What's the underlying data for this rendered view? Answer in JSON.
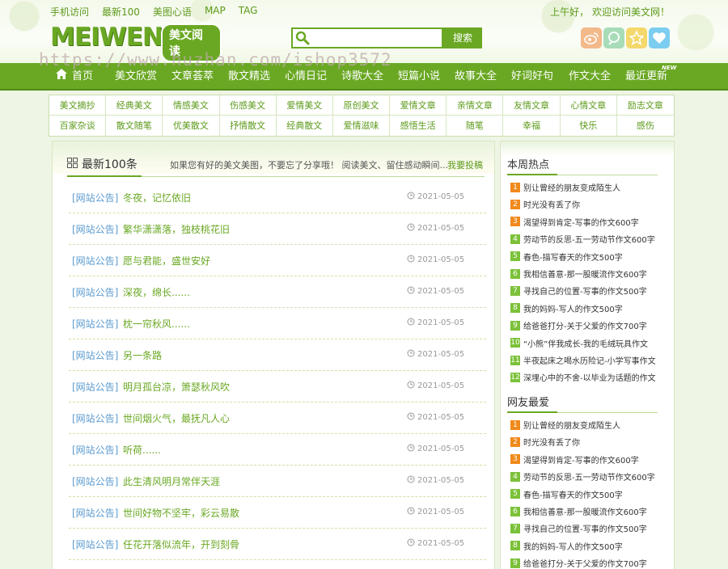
{
  "top": {
    "links": [
      "手机访问",
      "最新100",
      "美图心语",
      "MAP",
      "TAG"
    ],
    "greeting": "上午好，  欢迎访问美文网！",
    "logo_en": "MEIWEN",
    "logo_cn": "美文阅读",
    "search_placeholder": "",
    "search_button": "搜索",
    "watermark": "https://www.huzhan.com/ishop3572"
  },
  "icons": {
    "search": "magnifier-icon",
    "weibo": "weibo-icon",
    "qzone": "qzone-icon",
    "favorite": "star-icon",
    "love": "heart-icon"
  },
  "nav": {
    "items": [
      "首页",
      "美文欣赏",
      "文章荟萃",
      "散文精选",
      "心情日记",
      "诗歌大全",
      "短篇小说",
      "故事大全",
      "好词好句",
      "作文大全",
      "最近更新"
    ],
    "new_badge": "NEW"
  },
  "categories": [
    [
      "美文摘抄",
      "经典美文",
      "情感美文",
      "伤感美文",
      "爱情美文",
      "原创美文",
      "爱情文章",
      "亲情文章",
      "友情文章",
      "心情文章",
      "励志文章"
    ],
    [
      "百家杂谈",
      "散文随笔",
      "优美散文",
      "抒情散文",
      "经典散文",
      "爱情滋味",
      "感悟生活",
      "随笔",
      "幸福",
      "快乐",
      "感伤"
    ]
  ],
  "main": {
    "title": "最新100条",
    "tip": "如果您有好的美文美图，不要忘了分享哦！ 阅读美文、留住感动瞬间...",
    "contribute": "我要投稿",
    "articles": [
      {
        "cat": "[网站公告]",
        "title": "冬夜，记忆依旧",
        "date": "2021-05-05"
      },
      {
        "cat": "[网站公告]",
        "title": "繁华潇潇落，独枝桃花旧",
        "date": "2021-05-05"
      },
      {
        "cat": "[网站公告]",
        "title": "愿与君能，盛世安好",
        "date": "2021-05-05"
      },
      {
        "cat": "[网站公告]",
        "title": "深夜，绵长......",
        "date": "2021-05-05"
      },
      {
        "cat": "[网站公告]",
        "title": "枕一帘秋风......",
        "date": "2021-05-05"
      },
      {
        "cat": "[网站公告]",
        "title": "另一条路",
        "date": "2021-05-05"
      },
      {
        "cat": "[网站公告]",
        "title": "明月孤台凉，箫瑟秋风吹",
        "date": "2021-05-05"
      },
      {
        "cat": "[网站公告]",
        "title": "世间烟火气，最抚凡人心",
        "date": "2021-05-05"
      },
      {
        "cat": "[网站公告]",
        "title": "听荷......",
        "date": "2021-05-05"
      },
      {
        "cat": "[网站公告]",
        "title": "此生清风明月常伴天涯",
        "date": "2021-05-05"
      },
      {
        "cat": "[网站公告]",
        "title": "世间好物不坚牢，彩云易散",
        "date": "2021-05-05"
      },
      {
        "cat": "[网站公告]",
        "title": "任花开落似流年，开到刻骨",
        "date": "2021-05-05"
      }
    ]
  },
  "sidebar": {
    "hot_title": "本周热点",
    "fav_title": "网友最爱",
    "rank_colors": [
      "#f08a1c",
      "#f08a1c",
      "#f08a1c",
      "#7cc13a"
    ],
    "hot": [
      "别让曾经的朋友变成陌生人",
      "时光没有丢了你",
      "渴望得到肯定-写事的作文600字",
      "劳动节的反思-五一劳动节作文600字",
      "春色-描写春天的作文500字",
      "我相信善意-那一股暖流作文600字",
      "寻找自己的位置-写事的作文500字",
      "我的妈妈-写人的作文500字",
      "给爸爸打分-关于父爱的作文700字",
      "“小熊”伴我成长-我的毛绒玩具作文",
      "半夜起床之喝水历险记-小学写事作文",
      "深埋心中的不舍-以毕业为话题的作文"
    ],
    "fav": [
      "别让曾经的朋友变成陌生人",
      "时光没有丢了你",
      "渴望得到肯定-写事的作文600字",
      "劳动节的反思-五一劳动节作文600字",
      "春色-描写春天的作文500字",
      "我相信善意-那一股暖流作文600字",
      "寻找自己的位置-写事的作文500字",
      "我的妈妈-写人的作文500字",
      "给爸爸打分-关于父爱的作文700字"
    ],
    "fav_numbers": [
      "1",
      "2",
      "3",
      "4",
      "5",
      "6",
      "7",
      "8",
      "9"
    ],
    "hot_numbers": [
      "1",
      "2",
      "3",
      "4",
      "5",
      "6",
      "7",
      "8",
      "9",
      "10",
      "11",
      "12"
    ]
  }
}
